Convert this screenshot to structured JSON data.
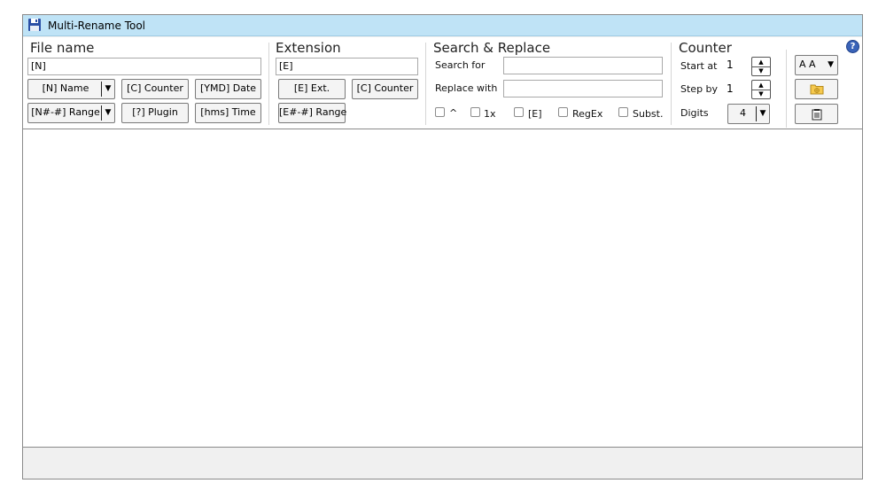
{
  "window": {
    "title": "Multi-Rename Tool"
  },
  "filename": {
    "title": "File name",
    "mask_value": "[N]",
    "buttons": {
      "name": "[N] Name",
      "counter": "[C] Counter",
      "date": "[YMD] Date",
      "range": "[N#-#] Range",
      "plugin": "[?] Plugin",
      "time": "[hms] Time"
    },
    "dropdown_glyph": "▼"
  },
  "extension": {
    "title": "Extension",
    "mask_value": "[E]",
    "buttons": {
      "ext": "[E] Ext.",
      "counter": "[C] Counter",
      "range": "[E#-#] Range"
    }
  },
  "search_replace": {
    "title": "Search & Replace",
    "search_label": "Search for",
    "search_value": "",
    "replace_label": "Replace with",
    "replace_value": "",
    "options": {
      "caret": "^",
      "once": "1x",
      "ext": "[E]",
      "regex": "RegEx",
      "subst": "Subst."
    }
  },
  "counter": {
    "title": "Counter",
    "start_label": "Start at",
    "start_value": "1",
    "step_label": "Step by",
    "step_value": "1",
    "digits_label": "Digits",
    "digits_value": "4",
    "spin_up": "▲",
    "spin_down": "▼"
  },
  "tools": {
    "case_label": "A A",
    "dropdown_glyph": "▼",
    "help_glyph": "?"
  },
  "icons": {
    "app": "floppy-disk-icon",
    "help": "help-icon",
    "folder": "folder-icon",
    "editor": "notepad-icon"
  },
  "colors": {
    "titlebar": "#bfe3f6",
    "help": "#3a63b8"
  }
}
